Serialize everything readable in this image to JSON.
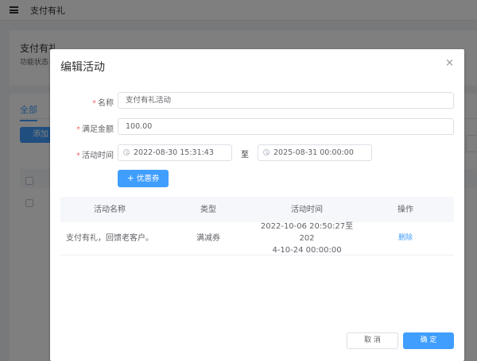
{
  "background": {
    "header_title": "支付有礼",
    "page_title": "支付有礼",
    "status_label": "功能状态：",
    "tab_all": "全部",
    "add_button": "添加"
  },
  "dialog": {
    "title": "编辑活动",
    "close_icon": "×",
    "form": {
      "name_label": "名称",
      "name_value": "支付有礼活动",
      "amount_label": "满足金额",
      "amount_value": "100.00",
      "time_label": "活动时间",
      "start_time": "2022-08-30 15:31:43",
      "range_separator": "至",
      "end_time": "2025-08-31 00:00:00",
      "required_mark": "*"
    },
    "coupon_button": "优惠券",
    "coupon_button_icon": "+",
    "table": {
      "columns": [
        "活动名称",
        "类型",
        "活动时间",
        "操作"
      ],
      "rows": [
        {
          "name": "支付有礼，回馈老客户。",
          "type": "满减券",
          "time_line1": "2022-10-06 20:50:27至202",
          "time_line2": "4-10-24 00:00:00",
          "action": "删除"
        }
      ]
    },
    "cancel_button": "取 消",
    "confirm_button": "确 定"
  },
  "colors": {
    "primary": "#409eff",
    "required": "#f56c6c",
    "overlay": "rgba(0,0,0,0.5)"
  }
}
